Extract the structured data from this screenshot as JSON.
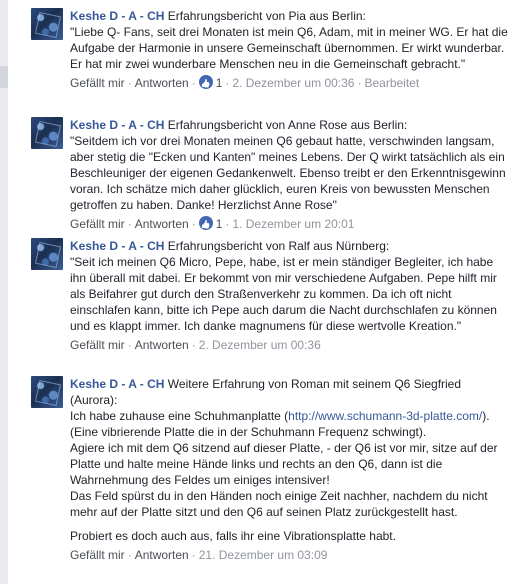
{
  "comments": [
    {
      "author": "Keshe D - A - CH",
      "intro": " Erfahrungsbericht von Pia aus Berlin:",
      "body": "\"Liebe Q- Fans, seit drei Monaten ist mein Q6, Adam, mit in meiner WG. Er hat die Aufgabe der Harmonie in unsere Gemeinschaft übernommen. Er wirkt wunderbar. Er hat mir zwei wunderbare Menschen neu in die Gemeinschaft gebracht.\"",
      "like_label": "Gefällt mir",
      "reply_label": "Antworten",
      "like_count": "1",
      "timestamp": "2. Dezember um 00:36",
      "edited": "Bearbeitet"
    },
    {
      "author": "Keshe D - A - CH",
      "intro": " Erfahrungsbericht von Anne Rose aus Berlin:",
      "body": "\"Seitdem ich vor drei Monaten meinen Q6 gebaut hatte, verschwinden langsam, aber stetig die \"Ecken und Kanten\" meines Lebens. Der Q wirkt tatsächlich als ein Beschleuniger der eigenen Gedankenwelt. Ebenso treibt er den Erkenntnisgewinn voran. Ich schätze mich daher glücklich, euren Kreis von bewussten Menschen getroffen zu haben. Danke! Herzlichst Anne Rose\"",
      "like_label": "Gefällt mir",
      "reply_label": "Antworten",
      "like_count": "1",
      "timestamp": "1. Dezember um 20:01"
    },
    {
      "author": "Keshe D - A - CH",
      "intro": " Erfahrungsbericht von Ralf aus Nürnberg:",
      "body": "\"Seit ich meinen Q6 Micro, Pepe, habe, ist er mein ständiger Begleiter, ich habe ihn überall mit dabei. Er bekommt von mir verschiedene Aufgaben. Pepe hilft mir als Beifahrer gut durch den Straßenverkehr zu kommen. Da ich oft nicht einschlafen kann, bitte ich Pepe auch darum die Nacht durchschlafen zu können und es klappt immer. Ich danke magnumens für diese wertvolle Kreation.\"",
      "like_label": "Gefällt mir",
      "reply_label": "Antworten",
      "timestamp": "2. Dezember um 00:36"
    },
    {
      "author": "Keshe D - A - CH",
      "intro": " Weitere Erfahrung von Roman mit seinem Q6 Siegfried (Aurora):",
      "body_before_link": "Ich habe zuhause eine Schuhmanplatte (",
      "link": "http://www.schumann-3d-platte.com/",
      "body_after_link": "). (Eine vibrierende Platte die in der Schuhmann Frequenz schwingt).\nAgiere ich mit dem Q6 sitzend auf dieser Platte, - der Q6 ist vor mir, sitze auf der Platte und halte meine Hände links und rechts an den Q6, dann ist die Wahrnehmung des Feldes um einiges intensiver!\nDas Feld spürst du in den Händen noch einige Zeit nachher, nachdem du nicht mehr auf der Platte sitzt und den Q6 auf seinen Platz zurückgestellt hast.",
      "closing": "Probiert es doch auch aus, falls ihr eine Vibrationsplatte habt.",
      "like_label": "Gefällt mir",
      "reply_label": "Antworten",
      "timestamp": "21. Dezember um 03:09"
    }
  ],
  "separator": "·",
  "colors": {
    "author": "#365899",
    "text": "#1d2129",
    "meta": "#90949c",
    "like_badge": "#4267b2"
  },
  "icons": {
    "avatar": "keshe-cube-avatar",
    "like": "thumbs-up-icon"
  }
}
